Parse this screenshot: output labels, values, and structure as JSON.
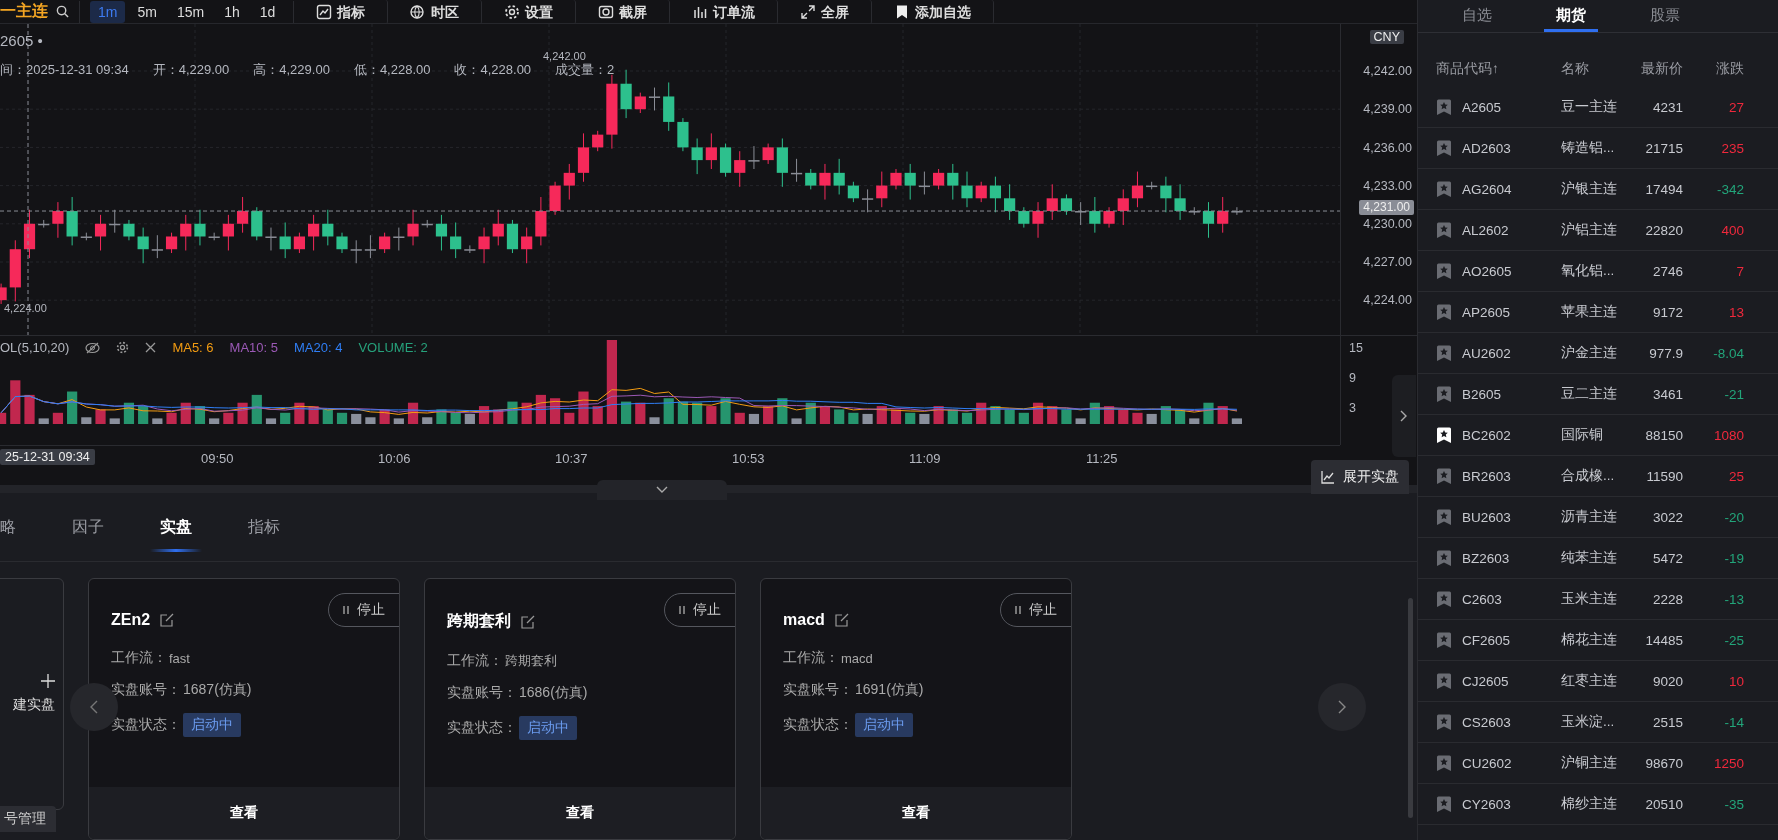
{
  "toolbar": {
    "symbol": "一主连",
    "timeframes": [
      {
        "label": "1m",
        "selected": true
      },
      {
        "label": "5m",
        "selected": false
      },
      {
        "label": "15m",
        "selected": false
      },
      {
        "label": "1h",
        "selected": false
      },
      {
        "label": "1d",
        "selected": false
      }
    ],
    "tools": [
      {
        "kind": "indicator",
        "label": "指标"
      },
      {
        "kind": "timezone",
        "label": "时区"
      },
      {
        "kind": "settings",
        "label": "设置"
      },
      {
        "kind": "screenshot",
        "label": "截屏"
      },
      {
        "kind": "orderflow",
        "label": "订单流"
      },
      {
        "kind": "fullscreen",
        "label": "全屏"
      },
      {
        "kind": "watchlist",
        "label": "添加自选"
      }
    ]
  },
  "chart": {
    "symbol": "2605 •",
    "ohlc": [
      "间：2025-12-31 09:34",
      "开：4,229.00",
      "高：4,229.00",
      "低：4,228.00",
      "收：4,228.00",
      "成交量：2"
    ],
    "high_label": "4,242.00",
    "low_label": "4,224.00",
    "currency": "CNY",
    "last_price": "4,231.00",
    "y_ticks": [
      "4,242.00",
      "4,239.00",
      "4,236.00",
      "4,233.00",
      "4,230.00",
      "4,227.00",
      "4,224.00"
    ],
    "volume": {
      "title": "OL(5,10,20)",
      "legend": [
        {
          "label": "MA5: 6",
          "color": "#f39c12"
        },
        {
          "label": "MA10: 5",
          "color": "#9b59b6"
        },
        {
          "label": "MA20: 4",
          "color": "#2f7ef5"
        },
        {
          "label": "VOLUME: 2",
          "color": "#26a17b"
        }
      ],
      "y_ticks": [
        "15",
        "9",
        "3"
      ]
    },
    "x_axis": {
      "cursor_label": "25-12-31 09:34",
      "ticks": [
        "09:50",
        "10:06",
        "10:37",
        "10:53",
        "11:09",
        "11:25"
      ]
    },
    "expand_button": "展开实盘"
  },
  "bottom": {
    "tabs": [
      {
        "label": "略",
        "selected": false
      },
      {
        "label": "因子",
        "selected": false
      },
      {
        "label": "实盘",
        "selected": true
      },
      {
        "label": "指标",
        "selected": false
      }
    ],
    "new_card": "建实盘",
    "account_button": "号管理",
    "cards": [
      {
        "name": "ZEn2",
        "workflow_label": "工作流：",
        "workflow": "fast",
        "account_label": "实盘账号：",
        "account": "1687(仿真)",
        "status_label": "实盘状态：",
        "status": "启动中",
        "stop": "停止",
        "view": "查看"
      },
      {
        "name": "跨期套利",
        "workflow_label": "工作流：",
        "workflow": "跨期套利",
        "account_label": "实盘账号：",
        "account": "1686(仿真)",
        "status_label": "实盘状态：",
        "status": "启动中",
        "stop": "停止",
        "view": "查看"
      },
      {
        "name": "macd",
        "workflow_label": "工作流：",
        "workflow": "macd",
        "account_label": "实盘账号：",
        "account": "1691(仿真)",
        "status_label": "实盘状态：",
        "status": "启动中",
        "stop": "停止",
        "view": "查看"
      }
    ]
  },
  "market": {
    "tabs": [
      {
        "label": "自选",
        "selected": false
      },
      {
        "label": "期货",
        "selected": true
      },
      {
        "label": "股票",
        "selected": false
      }
    ],
    "columns": [
      "商品代码↑",
      "名称",
      "最新价",
      "涨跌"
    ],
    "rows": [
      {
        "code": "A2605",
        "name": "豆一主连",
        "price": "4231",
        "change": "27",
        "color": "#f0283c",
        "favorite": false
      },
      {
        "code": "AD2603",
        "name": "铸造铝...",
        "price": "21715",
        "change": "235",
        "color": "#f0283c",
        "favorite": false
      },
      {
        "code": "AG2604",
        "name": "沪银主连",
        "price": "17494",
        "change": "-342",
        "color": "#22a57a",
        "favorite": false
      },
      {
        "code": "AL2602",
        "name": "沪铝主连",
        "price": "22820",
        "change": "400",
        "color": "#f0283c",
        "favorite": false
      },
      {
        "code": "AO2605",
        "name": "氧化铝...",
        "price": "2746",
        "change": "7",
        "color": "#f0283c",
        "favorite": false
      },
      {
        "code": "AP2605",
        "name": "苹果主连",
        "price": "9172",
        "change": "13",
        "color": "#f0283c",
        "favorite": false
      },
      {
        "code": "AU2602",
        "name": "沪金主连",
        "price": "977.9",
        "change": "-8.04",
        "color": "#22a57a",
        "favorite": false
      },
      {
        "code": "B2605",
        "name": "豆二主连",
        "price": "3461",
        "change": "-21",
        "color": "#22a57a",
        "favorite": false
      },
      {
        "code": "BC2602",
        "name": "国际铜",
        "price": "88150",
        "change": "1080",
        "color": "#f0283c",
        "favorite": true
      },
      {
        "code": "BR2603",
        "name": "合成橡...",
        "price": "11590",
        "change": "25",
        "color": "#f0283c",
        "favorite": false
      },
      {
        "code": "BU2603",
        "name": "沥青主连",
        "price": "3022",
        "change": "-20",
        "color": "#22a57a",
        "favorite": false
      },
      {
        "code": "BZ2603",
        "name": "纯苯主连",
        "price": "5472",
        "change": "-19",
        "color": "#22a57a",
        "favorite": false
      },
      {
        "code": "C2603",
        "name": "玉米主连",
        "price": "2228",
        "change": "-13",
        "color": "#22a57a",
        "favorite": false
      },
      {
        "code": "CF2605",
        "name": "棉花主连",
        "price": "14485",
        "change": "-25",
        "color": "#22a57a",
        "favorite": false
      },
      {
        "code": "CJ2605",
        "name": "红枣主连",
        "price": "9020",
        "change": "10",
        "color": "#f0283c",
        "favorite": false
      },
      {
        "code": "CS2603",
        "name": "玉米淀...",
        "price": "2515",
        "change": "-14",
        "color": "#22a57a",
        "favorite": false
      },
      {
        "code": "CU2602",
        "name": "沪铜主连",
        "price": "98670",
        "change": "1250",
        "color": "#f0283c",
        "favorite": false
      },
      {
        "code": "CY2603",
        "name": "棉纱主连",
        "price": "20510",
        "change": "-35",
        "color": "#22a57a",
        "favorite": false
      }
    ]
  }
}
